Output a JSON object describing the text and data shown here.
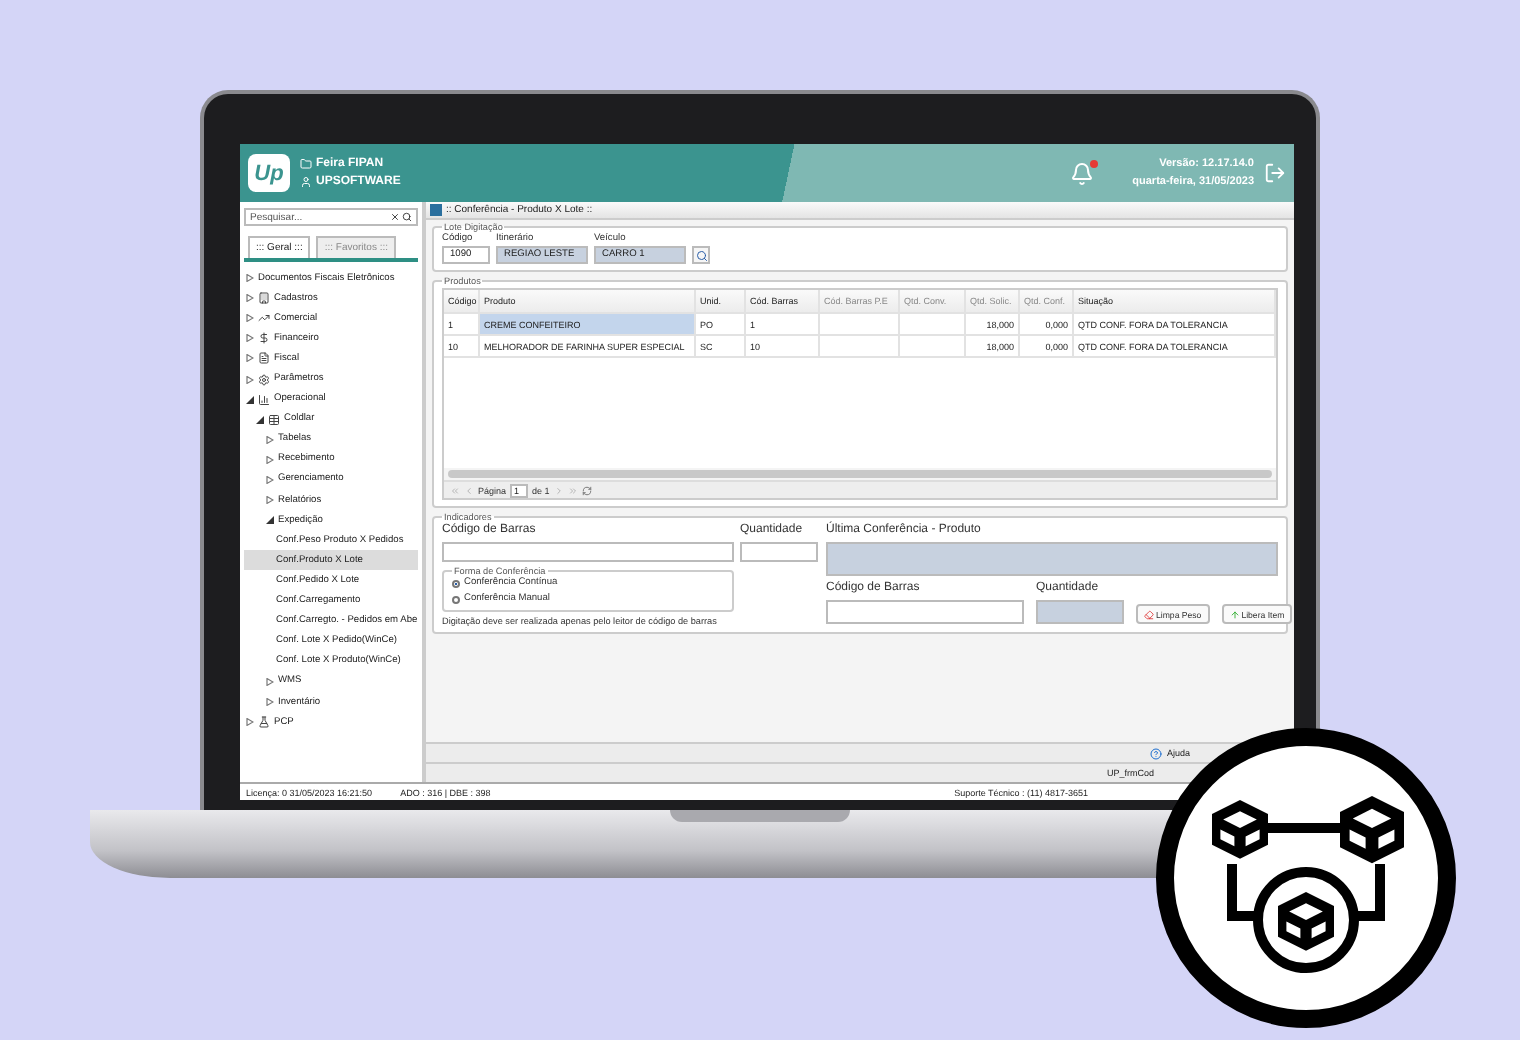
{
  "header": {
    "logo": "Up",
    "company": "Feira FIPAN",
    "user": "UPSOFTWARE",
    "version": "Versão: 12.17.14.0",
    "date": "quarta-feira, 31/05/2023"
  },
  "sidebar": {
    "search": {
      "placeholder": "Pesquisar..."
    },
    "tabs": [
      {
        "label": "::: Geral :::",
        "selected": true
      },
      {
        "label": "::: Favoritos :::",
        "selected": false
      }
    ],
    "tree": [
      {
        "label": "Documentos Fiscais Eletrônicos",
        "kind": "folder",
        "expanded": false,
        "selected": false
      },
      {
        "label": "Cadastros",
        "kind": "folder",
        "expanded": false,
        "selected": false
      },
      {
        "label": "Comercial",
        "kind": "folder",
        "expanded": false,
        "selected": false
      },
      {
        "label": "Financeiro",
        "kind": "folder",
        "expanded": false,
        "selected": false
      },
      {
        "label": "Fiscal",
        "kind": "folder",
        "expanded": false,
        "selected": false
      },
      {
        "label": "Parâmetros",
        "kind": "folder",
        "expanded": false,
        "selected": false
      },
      {
        "label": "Operacional",
        "kind": "folder",
        "expanded": true,
        "selected": false,
        "children": [
          {
            "label": "Coldlar",
            "kind": "folder",
            "expanded": true,
            "selected": false,
            "children": [
              {
                "label": "Tabelas",
                "kind": "folder",
                "expanded": false,
                "selected": false
              },
              {
                "label": "Recebimento",
                "kind": "folder",
                "expanded": false,
                "selected": false
              },
              {
                "label": "Gerenciamento",
                "kind": "folder",
                "expanded": false,
                "selected": false
              },
              {
                "label": "Relatórios",
                "kind": "folder",
                "expanded": false,
                "selected": false
              },
              {
                "label": "Expedição",
                "kind": "folder",
                "expanded": true,
                "selected": false,
                "children": [
                  {
                    "label": "Conf.Peso Produto X Pedidos",
                    "kind": "leaf",
                    "selected": false
                  },
                  {
                    "label": "Conf.Produto X Lote",
                    "kind": "leaf",
                    "selected": true
                  },
                  {
                    "label": "Conf.Pedido X Lote",
                    "kind": "leaf",
                    "selected": false
                  },
                  {
                    "label": "Conf.Carregamento",
                    "kind": "leaf",
                    "selected": false
                  },
                  {
                    "label": "Conf.Carregto. - Pedidos em Abe",
                    "kind": "leaf",
                    "selected": false
                  },
                  {
                    "label": "Conf. Lote X Pedido(WinCe)",
                    "kind": "leaf",
                    "selected": false
                  },
                  {
                    "label": "Conf. Lote X Produto(WinCe)",
                    "kind": "leaf",
                    "selected": false
                  }
                ]
              },
              {
                "label": "WMS",
                "kind": "folder",
                "expanded": false,
                "selected": false
              },
              {
                "label": "Inventário",
                "kind": "folder",
                "expanded": false,
                "selected": false
              }
            ]
          }
        ]
      },
      {
        "label": "PCP",
        "kind": "folder",
        "expanded": false,
        "selected": false
      }
    ]
  },
  "window": {
    "title": ":: Conferência - Produto X Lote ::"
  },
  "lote": {
    "title": "Lote Digitação",
    "fields": [
      {
        "label": "Código",
        "value": "1090",
        "readonly": false
      },
      {
        "label": "Itinerário",
        "value": "REGIAO LESTE",
        "readonly": true
      },
      {
        "label": "Veículo",
        "value": "CARRO 1",
        "readonly": true
      }
    ]
  },
  "produtos": {
    "title": "Produtos",
    "columns": [
      {
        "label": "Código",
        "muted": false
      },
      {
        "label": "Produto",
        "muted": false
      },
      {
        "label": "Unid.",
        "muted": false
      },
      {
        "label": "Cód. Barras",
        "muted": false
      },
      {
        "label": "Cód. Barras P.E",
        "muted": true
      },
      {
        "label": "Qtd. Conv.",
        "muted": true
      },
      {
        "label": "Qtd. Solic.",
        "muted": true
      },
      {
        "label": "Qtd. Conf.",
        "muted": true
      },
      {
        "label": "Situação",
        "muted": false
      }
    ],
    "rows": [
      {
        "selected": true,
        "cells": [
          "1",
          "CREME CONFEITEIRO",
          "PO",
          "1",
          null,
          null,
          "18,000",
          "0,000",
          "QTD CONF. FORA DA TOLERANCIA"
        ]
      },
      {
        "selected": false,
        "cells": [
          "10",
          "MELHORADOR DE FARINHA SUPER ESPECIAL",
          "SC",
          "10",
          null,
          null,
          "18,000",
          "0,000",
          "QTD CONF. FORA DA TOLERANCIA"
        ]
      }
    ],
    "pager": {
      "label": "Página",
      "page": "1",
      "of": "de 1"
    }
  },
  "indicadores": {
    "title": "Indicadores",
    "barcode_label": "Código de Barras",
    "quantity_label": "Quantidade",
    "last_label": "Última Conferência - Produto",
    "mode": {
      "title": "Forma de Conferência",
      "options": [
        {
          "label": "Conferência Contínua",
          "selected": true
        },
        {
          "label": "Conferência Manual",
          "selected": false
        }
      ]
    },
    "hint": "Digitação deve ser realizada apenas pelo leitor de código de barras",
    "barcode2_label": "Código de Barras",
    "quantity2_label": "Quantidade",
    "buttons": [
      {
        "label": "Limpa Peso",
        "kind": "clear"
      },
      {
        "label": "Libera Item",
        "kind": "release"
      }
    ]
  },
  "footer": {
    "help": "Ajuda",
    "form": "UP_frmCod"
  },
  "status_bar": {
    "license": "Licença: 0 31/05/2023 16:21:50",
    "db": "ADO : 316 | DBE : 398",
    "support": "Suporte Técnico : (11) 4817-3651"
  }
}
